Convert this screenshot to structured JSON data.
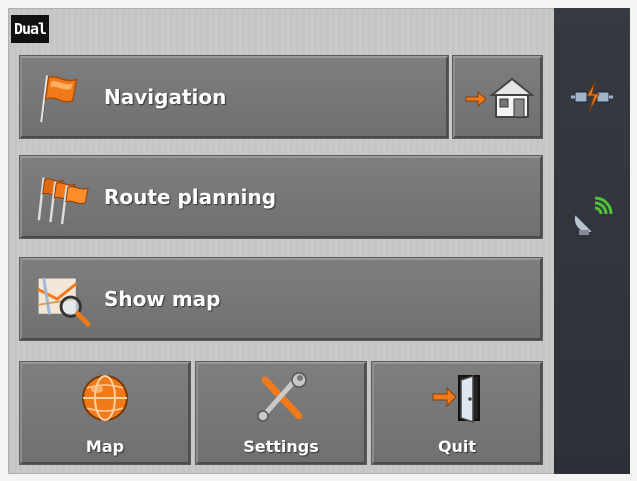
{
  "brand": {
    "logo_text": "Dual"
  },
  "menu": {
    "navigation_label": "Navigation",
    "route_planning_label": "Route planning",
    "show_map_label": "Show map"
  },
  "bottom": {
    "map_label": "Map",
    "settings_label": "Settings",
    "quit_label": "Quit"
  },
  "colors": {
    "button": "#777777",
    "background": "#c8c8c8",
    "sidebar": "#31373d",
    "accent_orange": "#f07a1a",
    "gps_green": "#4fc23a"
  },
  "icons": {
    "navigation": "flag-icon",
    "home": "home-icon",
    "route_planning": "flags-icon",
    "show_map": "map-search-icon",
    "map": "globe-icon",
    "settings": "tools-icon",
    "quit": "exit-door-icon",
    "connection": "connection-icon",
    "gps": "gps-satellite-icon"
  }
}
